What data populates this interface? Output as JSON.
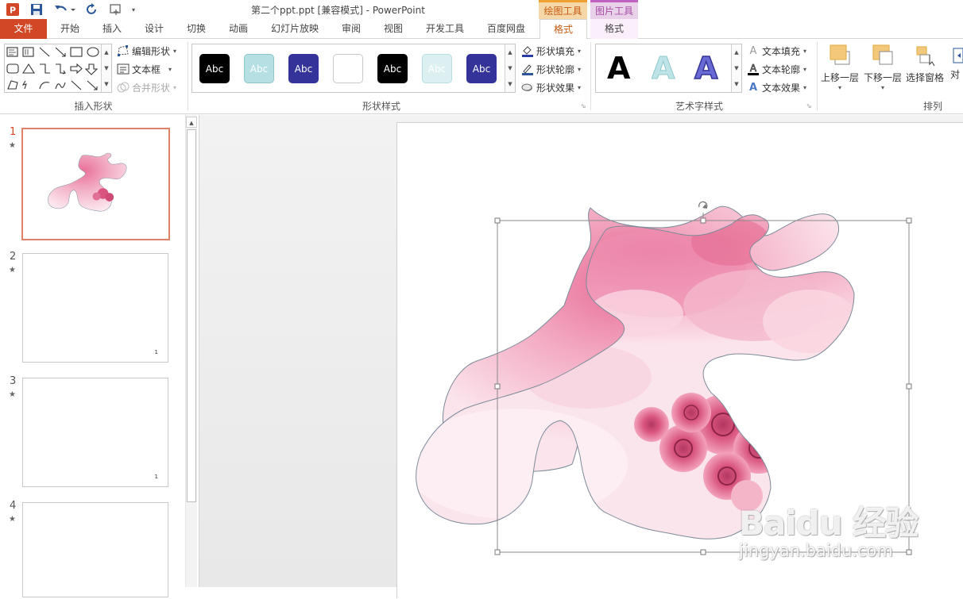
{
  "window": {
    "title": "第二个ppt.ppt [兼容模式] - PowerPoint",
    "context_tools": [
      "绘图工具",
      "图片工具"
    ]
  },
  "quick_access": [
    {
      "icon": "powerpoint-logo-icon"
    },
    {
      "icon": "save-icon"
    },
    {
      "icon": "undo-icon"
    },
    {
      "icon": "redo-icon"
    },
    {
      "icon": "touch-mode-icon"
    },
    {
      "icon": "customize-qat-icon"
    }
  ],
  "tabs": [
    {
      "label": "文件"
    },
    {
      "label": "开始"
    },
    {
      "label": "插入"
    },
    {
      "label": "设计"
    },
    {
      "label": "切换"
    },
    {
      "label": "动画"
    },
    {
      "label": "幻灯片放映"
    },
    {
      "label": "审阅"
    },
    {
      "label": "视图"
    },
    {
      "label": "开发工具"
    },
    {
      "label": "百度网盘"
    },
    {
      "label": "格式"
    },
    {
      "label": "格式"
    }
  ],
  "ribbon": {
    "insert_shapes": {
      "label": "插入形状",
      "edit_shape": "编辑形状",
      "text_box": "文本框",
      "merge_shapes": "合并形状"
    },
    "shape_styles": {
      "label": "形状样式",
      "swatch_text": "Abc",
      "swatches": [
        {
          "bg": "#000000",
          "fg": "#ffffff",
          "border": "#000000"
        },
        {
          "bg": "#b5dfe3",
          "fg": "#ffffff",
          "border": "#8cc7cc"
        },
        {
          "bg": "#333399",
          "fg": "#ffffff",
          "border": "#333399"
        },
        {
          "bg": "#ffffff",
          "fg": "#ffffff",
          "border": "#c8c8c8"
        },
        {
          "bg": "#000000",
          "fg": "#ffffff",
          "border": "#000000"
        },
        {
          "bg": "#dcf0f2",
          "fg": "#ffffff",
          "border": "#b5dfe3"
        },
        {
          "bg": "#333399",
          "fg": "#ffffff",
          "border": "#333399"
        }
      ],
      "fill": "形状填充",
      "outline": "形状轮廓",
      "effects": "形状效果"
    },
    "wordart": {
      "label": "艺术字样式",
      "letter": "A",
      "text_fill": "文本填充",
      "text_outline": "文本轮廓",
      "text_effects": "文本效果"
    },
    "arrange": {
      "label": "排列",
      "bring_forward": "上移一层",
      "send_backward": "下移一层",
      "selection_pane": "选择窗格",
      "align_partial": "对"
    }
  },
  "slides": [
    {
      "number": "1",
      "star": "★",
      "mark": ""
    },
    {
      "number": "2",
      "star": "★",
      "mark": "1"
    },
    {
      "number": "3",
      "star": "★",
      "mark": "1"
    },
    {
      "number": "4",
      "star": "★",
      "mark": ""
    }
  ],
  "watermark": {
    "brand": "Baidu 经验",
    "url": "jingyan.baidu.com"
  },
  "colors": {
    "file_tab": "#d24726",
    "selected_thumb_border": "#e0826a",
    "drawing_tools": "#f0a030",
    "picture_tools": "#c060c0"
  }
}
